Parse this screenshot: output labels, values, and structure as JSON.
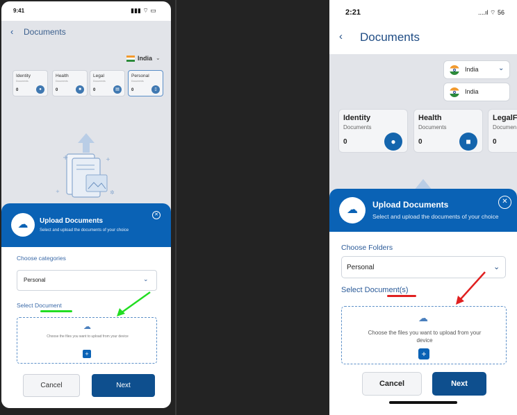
{
  "left": {
    "status_time": "9:41",
    "nav": {
      "back": "‹",
      "title": "Documents"
    },
    "country": "India",
    "cards": [
      {
        "name": "Identity",
        "sub": "Documents",
        "count": "0"
      },
      {
        "name": "Health",
        "sub": "Documents",
        "count": "0"
      },
      {
        "name": "Legal",
        "sub": "Documents",
        "count": "0"
      },
      {
        "name": "Personal",
        "sub": "Documents",
        "count": "0"
      }
    ],
    "sheet": {
      "title": "Upload Documents",
      "subtitle": "Select and upload the documents of your choice"
    },
    "choose_label": "Choose categories",
    "selected_value": "Personal",
    "select_label": "Select Document",
    "drop_text": "Choose the files you want to upload from your device",
    "cancel": "Cancel",
    "next": "Next"
  },
  "right": {
    "status_time": "2:21",
    "status_icons": "....ıl ⌔ 56",
    "nav": {
      "back": "‹",
      "title": "Documents"
    },
    "dropdown_value": "India",
    "dropdown_option": "India",
    "cards": [
      {
        "name": "Identity",
        "sub": "Documents",
        "count": "0"
      },
      {
        "name": "Health",
        "sub": "Documents",
        "count": "0"
      },
      {
        "name": "LegalFi",
        "sub": "Documen",
        "count": "0"
      }
    ],
    "sheet": {
      "title": "Upload Documents",
      "subtitle": "Select and upload the documents of your choice"
    },
    "choose_label": "Choose Folders",
    "selected_value": "Personal",
    "select_label": "Select Document(s)",
    "drop_text": "Choose the files you want to upload from your device",
    "cancel": "Cancel",
    "next": "Next"
  },
  "colors": {
    "primary": "#0a62b5",
    "button": "#0e4f8e",
    "green_annotation": "#22dd22",
    "red_annotation": "#e02020"
  },
  "icons": [
    "back-chevron-icon",
    "india-flag-icon",
    "chevron-down-icon",
    "person-icon",
    "lock-icon",
    "document-icon",
    "cloud-upload-icon",
    "close-icon",
    "plus-icon"
  ]
}
